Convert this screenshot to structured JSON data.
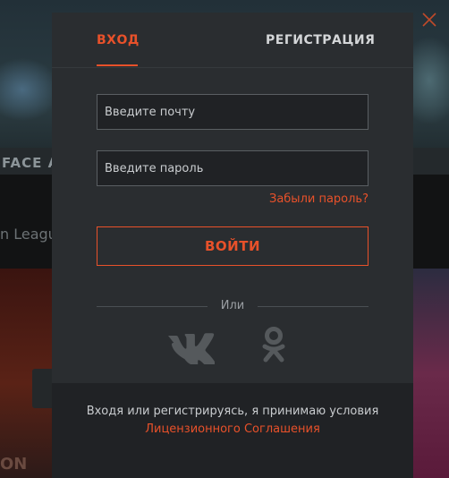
{
  "background": {
    "banner_strip_text": "FACE A",
    "sub_text": "n League",
    "card_text": "ON"
  },
  "modal": {
    "tabs": {
      "login_label": "ВХОД",
      "register_label": "РЕГИСТРАЦИЯ",
      "active_tab": "login"
    },
    "email": {
      "placeholder": "Введите почту",
      "value": ""
    },
    "password": {
      "placeholder": "Введите пароль",
      "value": ""
    },
    "forgot_password_label": "Забыли пароль?",
    "login_button_label": "ВОЙТИ",
    "or_label": "Или",
    "social": [
      {
        "name": "vk",
        "icon": "vk-icon"
      },
      {
        "name": "odnoklassniki",
        "icon": "odnoklassniki-icon"
      }
    ],
    "footer": {
      "text": "Входя или регистрируясь, я принимаю условия",
      "link_label": "Лицензионного Соглашения"
    }
  },
  "colors": {
    "accent": "#e8512a",
    "modal_bg": "#2a2d30",
    "footer_bg": "#202225",
    "icon_gray": "#55595c"
  }
}
